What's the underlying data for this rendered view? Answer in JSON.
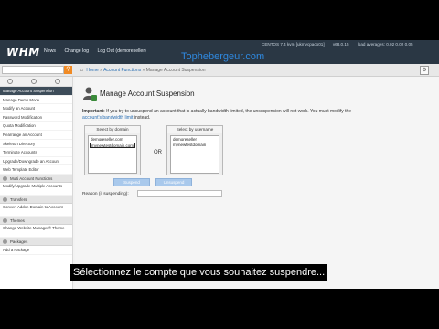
{
  "topbar": {
    "logo": "WHM",
    "nav": [
      "News",
      "Change log",
      "Log Out (demoreseller)"
    ],
    "brand": "Tophebergeur.com",
    "sysinfo": [
      "CENTOS 7.4 kvm [ukmvcpaco01]",
      "v68.0.15",
      "load averages: 0.02 0.02 0.05"
    ]
  },
  "subbar": {
    "search_icon": "search-icon",
    "breadcrumb": [
      "Home",
      "Account Functions",
      "Manage Account Suspension"
    ],
    "help_icon": "help-icon"
  },
  "sidebar": {
    "items": [
      {
        "label": "Manage Account Suspension",
        "active": true
      },
      {
        "label": "Manage Demo Mode"
      },
      {
        "label": "Modify an Account"
      },
      {
        "label": "Password Modification"
      },
      {
        "label": "Quota Modification"
      },
      {
        "label": "Rearrange an Account"
      },
      {
        "label": "Skeleton Directory"
      },
      {
        "label": "Terminate Accounts"
      },
      {
        "label": "Upgrade/Downgrade an Account"
      },
      {
        "label": "Web Template Editor"
      },
      {
        "label": "Multi Account Functions"
      },
      {
        "label": "Modify/Upgrade Multiple Accounts"
      }
    ],
    "section_transfers": "Transfers",
    "transfers_items": [
      "Convert Addon Domain to Account"
    ],
    "section_themes": "Themes",
    "themes_items": [
      "Change Website Manager® Theme"
    ],
    "section_packages": "Packages",
    "packages_items": [
      "Add a Package"
    ]
  },
  "main": {
    "title": "Manage Account Suspension",
    "note_important": "Important:",
    "note_text": "If you try to unsuspend an account that is actually bandwidth limited, the unsuspension will not work. You must modify the",
    "note_link": "account's bandwidth limit",
    "note_end": "instead.",
    "by_domain": {
      "header": "Select by domain",
      "options": [
        "demoreseller.com",
        "mynewtestdomain.com"
      ],
      "selected_index": 1
    },
    "or_label": "OR",
    "by_username": {
      "header": "Select by username",
      "options": [
        "demoreseller",
        "mynewtestdomain"
      ]
    },
    "suspend_button": "Suspend",
    "unsuspend_button": "Unsuspend",
    "reason_label": "Reason (if suspending):",
    "reason_value": ""
  },
  "subtitle": "Sélectionnez le compte que vous souhaitez suspendre..."
}
